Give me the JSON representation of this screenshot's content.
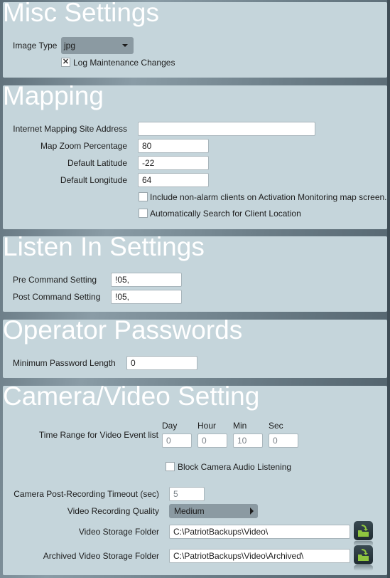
{
  "misc": {
    "title": "Misc Settings",
    "image_type_label": "Image Type",
    "image_type_value": "jpg",
    "log_maintenance_label": "Log Maintenance Changes",
    "log_maintenance_checked": true,
    "log_maintenance_mark": "✕"
  },
  "mapping": {
    "title": "Mapping",
    "site_address_label": "Internet Mapping Site Address",
    "site_address_value": "",
    "zoom_label": "Map Zoom Percentage",
    "zoom_value": "80",
    "latitude_label": "Default Latitude",
    "latitude_value": "-22",
    "longitude_label": "Default Longitude",
    "longitude_value": "64",
    "include_nonalarm_label": "Include non-alarm clients on Activation Monitoring map screen.",
    "include_nonalarm_checked": false,
    "auto_search_label": "Automatically Search for Client Location",
    "auto_search_checked": false
  },
  "listen_in": {
    "title": "Listen In Settings",
    "pre_label": "Pre Command Setting",
    "pre_value": "!05,",
    "post_label": "Post Command Setting",
    "post_value": "!05,"
  },
  "passwords": {
    "title": "Operator Passwords",
    "min_length_label": "Minimum Password Length",
    "min_length_value": "0"
  },
  "camera": {
    "title": "Camera/Video Setting",
    "time_range_label": "Time Range for Video Event list",
    "day_label": "Day",
    "day_value": "0",
    "hour_label": "Hour",
    "hour_value": "0",
    "min_label": "Min",
    "min_value": "10",
    "sec_label": "Sec",
    "sec_value": "0",
    "block_audio_label": "Block Camera Audio Listening",
    "block_audio_checked": false,
    "timeout_label": "Camera Post-Recording Timeout (sec)",
    "timeout_value": "5",
    "quality_label": "Video Recording Quality",
    "quality_value": "Medium",
    "storage_label": "Video Storage Folder",
    "storage_value": "C:\\PatriotBackups\\Video\\",
    "archive_label": "Archived Video Storage Folder",
    "archive_value": "C:\\PatriotBackups\\Video\\Archived\\"
  },
  "colors": {
    "panel_bg": "#c5d5db",
    "folder_icon": "#8fc63f"
  }
}
